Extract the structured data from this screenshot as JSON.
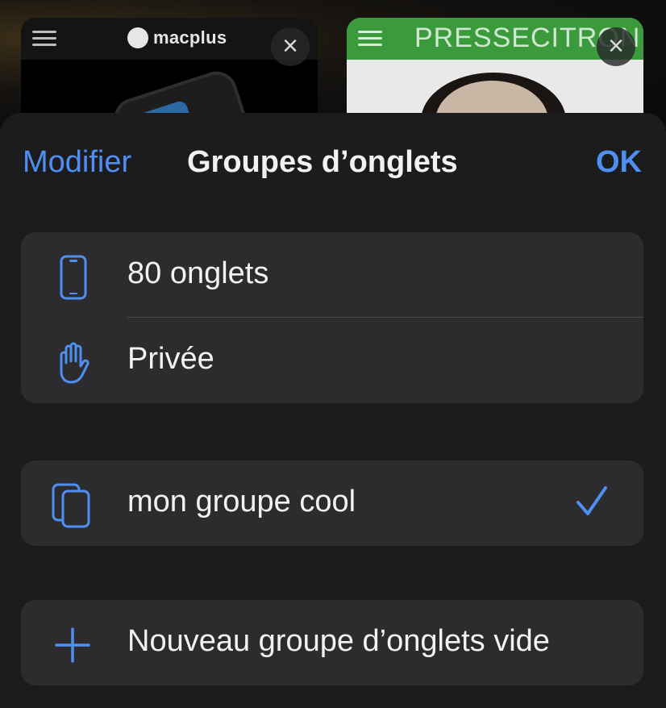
{
  "colors": {
    "accent": "#4e8ff0",
    "sheet_bg": "#1c1c1e",
    "group_bg": "#2c2c2e",
    "text": "#f2f2f2"
  },
  "background_tabs": [
    {
      "site": "macplus",
      "close_icon": "close-icon"
    },
    {
      "site": "PRESSECITRON",
      "close_icon": "close-icon"
    }
  ],
  "header": {
    "edit_label": "Modifier",
    "title": "Groupes d’onglets",
    "done_label": "OK"
  },
  "groups": {
    "default": [
      {
        "label": "80 onglets",
        "icon": "iphone-icon"
      },
      {
        "label": "Privée",
        "icon": "hand-icon"
      }
    ],
    "custom": [
      {
        "label": "mon groupe cool",
        "icon": "tab-group-icon",
        "selected": true
      }
    ],
    "new": {
      "label": "Nouveau groupe d’onglets vide",
      "icon": "plus-icon"
    }
  }
}
